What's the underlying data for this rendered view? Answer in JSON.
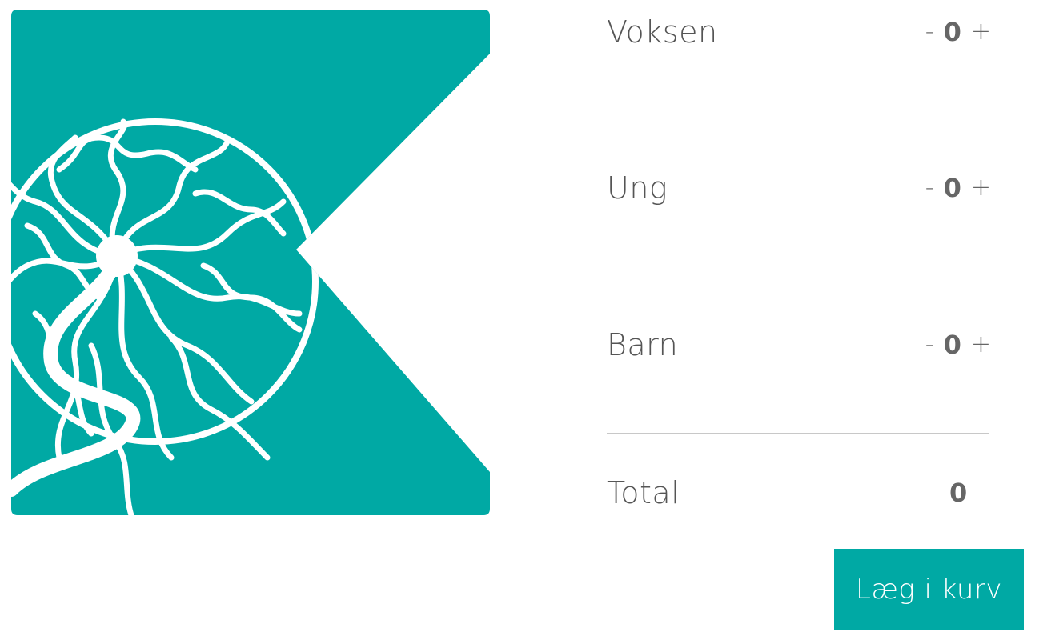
{
  "logo": {
    "icon": "tree-of-life-logo-icon",
    "color": "#00a9a4"
  },
  "tickets": [
    {
      "label": "Voksen",
      "minus": "-",
      "qty": "0",
      "plus": "+"
    },
    {
      "label": "Ung",
      "minus": "-",
      "qty": "0",
      "plus": "+"
    },
    {
      "label": "Barn",
      "minus": "-",
      "qty": "0",
      "plus": "+"
    }
  ],
  "total": {
    "label": "Total",
    "value": "0"
  },
  "cart_button": {
    "label": "Læg i kurv",
    "color": "#00a9a4"
  }
}
